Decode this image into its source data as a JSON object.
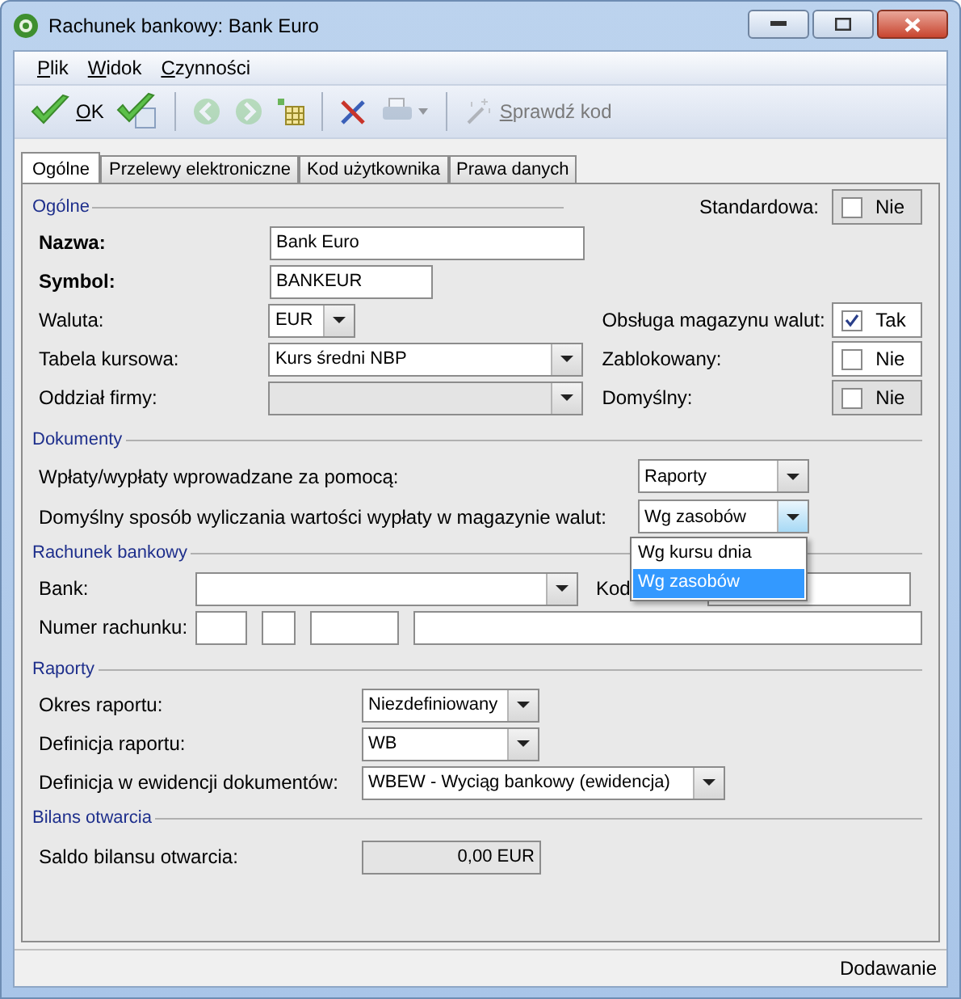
{
  "window": {
    "title": "Rachunek bankowy: Bank Euro"
  },
  "menu": [
    {
      "label": "Plik"
    },
    {
      "label": "Widok"
    },
    {
      "label": "Czynności"
    }
  ],
  "toolbar": [
    {
      "kind": "ok",
      "label": "OK",
      "disabled": false
    },
    {
      "kind": "save",
      "disabled": false
    },
    {
      "kind": "back",
      "disabled": true
    },
    {
      "kind": "forward",
      "disabled": true
    },
    {
      "kind": "grid",
      "disabled": false
    },
    {
      "kind": "tools",
      "disabled": false
    },
    {
      "kind": "print",
      "disabled": true
    },
    {
      "kind": "wand",
      "label": "Sprawdź kod",
      "disabled": true
    }
  ],
  "tabs": [
    {
      "label": "Ogólne",
      "selected": true
    },
    {
      "label": "Przelewy elektroniczne",
      "selected": false
    },
    {
      "label": "Kod użytkownika",
      "selected": false
    },
    {
      "label": "Prawa danych",
      "selected": false
    }
  ],
  "general": {
    "title": "Ogólne",
    "standard": {
      "label": "Standardowa:",
      "text": "Nie",
      "checked": false,
      "disabled": true
    },
    "fields": [
      {
        "label": "Nazwa:",
        "bold": true,
        "kind": "text",
        "value": "Bank Euro"
      },
      {
        "label": "Symbol:",
        "bold": true,
        "kind": "text",
        "value": "BANKEUR"
      },
      {
        "label": "Waluta:",
        "bold": false,
        "kind": "combo",
        "value": "EUR",
        "disabled": false
      },
      {
        "label": "Tabela kursowa:",
        "bold": false,
        "kind": "combo",
        "value": "Kurs średni NBP",
        "disabled": false
      },
      {
        "label": "Oddział firmy:",
        "bold": false,
        "kind": "combo",
        "disabled": true
      }
    ],
    "flags": [
      {
        "label": "Obsługa magazynu walut:",
        "text": "Tak",
        "checked": true,
        "disabled": false
      },
      {
        "label": "Zablokowany:",
        "text": "Nie",
        "checked": false,
        "disabled": false
      },
      {
        "label": "Domyślny:",
        "text": "Nie",
        "checked": false,
        "disabled": true
      }
    ]
  },
  "documents": {
    "title": "Dokumenty",
    "fields": [
      {
        "label": "Wpłaty/wypłaty wprowadzane za pomocą:",
        "value": "Raporty",
        "expanded": false
      },
      {
        "label": "Domyślny sposób wyliczania wartości wypłaty w magazynie walut:",
        "value": "Wg zasobów",
        "expanded": true,
        "options": [
          {
            "label": "Wg kursu dnia",
            "selected": false
          },
          {
            "label": "Wg zasobów",
            "selected": true
          }
        ]
      }
    ]
  },
  "account": {
    "title": "Rachunek bankowy",
    "bank_label": "Bank:",
    "swift_label": "Kod",
    "number_label": "Numer rachunku:"
  },
  "reports": {
    "title": "Raporty",
    "fields": [
      {
        "label": "Okres raportu:",
        "value": "Niezdefiniowany"
      },
      {
        "label": "Definicja raportu:",
        "value": "WB"
      },
      {
        "label": "Definicja w ewidencji dokumentów:",
        "value": "WBEW - Wyciąg bankowy (ewidencja)"
      }
    ]
  },
  "opening": {
    "title": "Bilans otwarcia",
    "label": "Saldo bilansu otwarcia:",
    "value": "0,00 EUR"
  },
  "status_bar": {
    "text": "Dodawanie"
  }
}
